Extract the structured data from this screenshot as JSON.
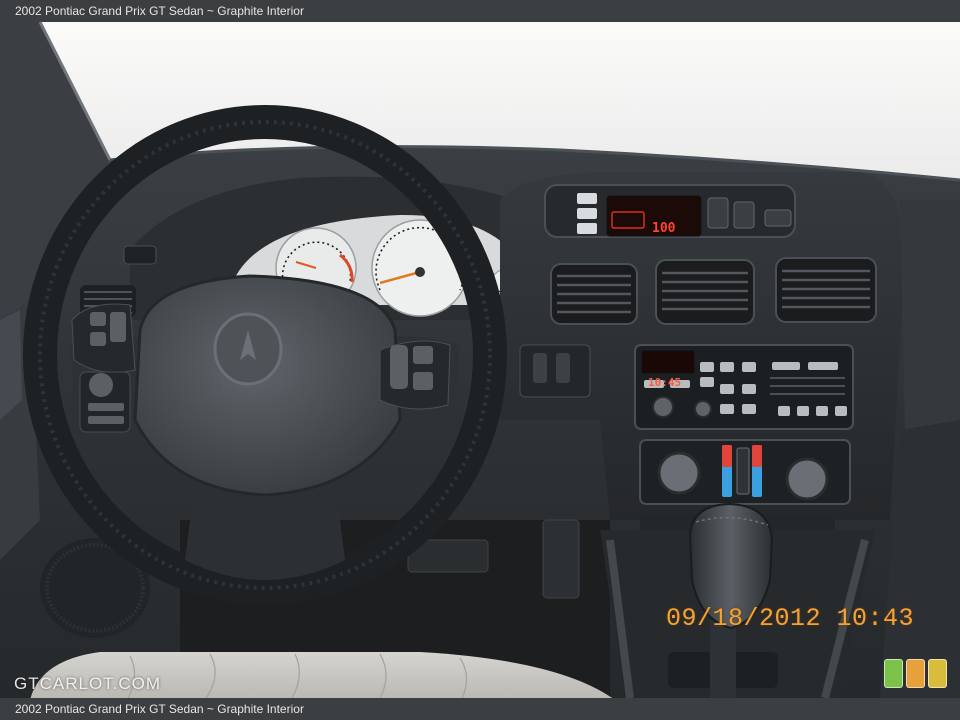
{
  "caption": {
    "title": "2002 Pontiac Grand Prix GT Sedan ~ Graphite Interior"
  },
  "photo": {
    "date_stamp": "09/18/2012 10:43",
    "watermark": "GTCARLOT.COM",
    "radio_display": "100",
    "clock_display": "10:45"
  },
  "colors": {
    "dash": "#2f3336",
    "windshield": "#f3f3f1",
    "stamp": "#f2a23a",
    "swatch_green": "#7cc24a",
    "swatch_orange": "#e8a13a",
    "swatch_yellow": "#d8bd3c"
  }
}
